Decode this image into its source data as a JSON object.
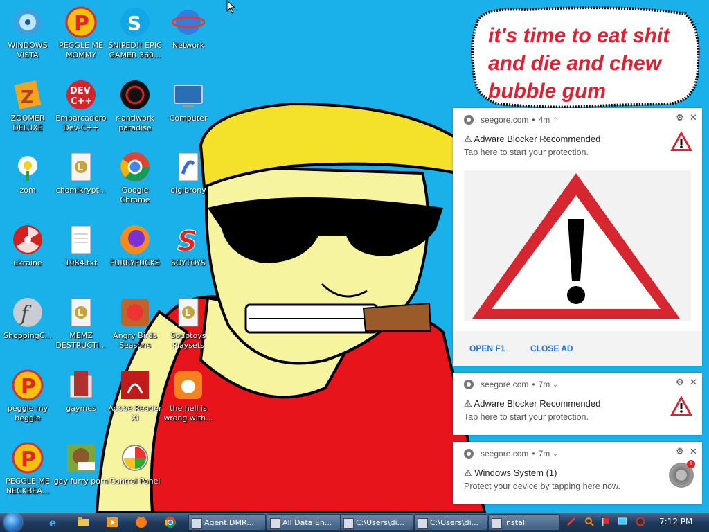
{
  "desktop": {
    "icons": [
      {
        "label": "WINDOWS VISTA",
        "icon": "vista-disc-icon"
      },
      {
        "label": "PEGGLE ME MOMMY",
        "icon": "peggle-icon"
      },
      {
        "label": "SNIPED!! EPIC GAMER 360...",
        "icon": "skype-icon"
      },
      {
        "label": "Network",
        "icon": "network-globe-icon"
      },
      {
        "label": "ZOOMER DELUXE",
        "icon": "zuma-icon"
      },
      {
        "label": "Embarcadero Dev-C++",
        "icon": "devcpp-icon"
      },
      {
        "label": "r-antiwork paradise",
        "icon": "antiwork-icon"
      },
      {
        "label": "Computer",
        "icon": "computer-icon"
      },
      {
        "label": "zom",
        "icon": "plants-icon"
      },
      {
        "label": "chomikrypt...",
        "icon": "shortcut-file-icon"
      },
      {
        "label": "Google Chrome",
        "icon": "chrome-icon"
      },
      {
        "label": "digibrony",
        "icon": "digibrony-icon"
      },
      {
        "label": "ukraine",
        "icon": "radiation-icon"
      },
      {
        "label": "1984.txt",
        "icon": "text-file-icon"
      },
      {
        "label": "FURRYFUCKS",
        "icon": "firefox-icon"
      },
      {
        "label": "SOYTOYS",
        "icon": "s-logo-icon"
      },
      {
        "label": "ShoppingC...",
        "icon": "flash-icon"
      },
      {
        "label": "MEMZ DESTRUCTI...",
        "icon": "shortcut-file-icon"
      },
      {
        "label": "Angry Birds Seasons",
        "icon": "angry-birds-icon"
      },
      {
        "label": "Souptoys Playsets",
        "icon": "shortcut-file-icon"
      },
      {
        "label": "peggle my heggle",
        "icon": "peggle-icon"
      },
      {
        "label": "gaymes",
        "icon": "folder-icon"
      },
      {
        "label": "Adobe Reader XI",
        "icon": "adobe-reader-icon"
      },
      {
        "label": "the hell is wrong with...",
        "icon": "uc-browser-icon"
      },
      {
        "label": "PEGGLE ME NECKBEA...",
        "icon": "peggle-icon"
      },
      {
        "label": "gay furry porn",
        "icon": "box-icon"
      },
      {
        "label": "Control Panel",
        "icon": "control-panel-icon"
      }
    ]
  },
  "wallpaper": {
    "speech_bubble_lines": [
      "it's time to eat shit",
      "and die and chew",
      "bubble gum"
    ]
  },
  "notifications": [
    {
      "site": "seegore.com",
      "age": "4m",
      "title": "⚠ Adware Blocker Recommended",
      "body": "Tap here to start your protection.",
      "actions": [
        "OPEN F1",
        "CLOSE AD"
      ]
    },
    {
      "site": "seegore.com",
      "age": "7m",
      "title": "⚠ Adware Blocker Recommended",
      "body": "Tap here to start your protection."
    },
    {
      "site": "seegore.com",
      "age": "7m",
      "title": "⚠ Windows System (1)",
      "body": "Protect your device by tapping here now.",
      "badge": "1"
    }
  ],
  "notification_meta": {
    "separator": "•",
    "gear_glyph": "⚙",
    "close_glyph": "✕",
    "chevron_up": "⌃",
    "chevron_down": "⌄"
  },
  "taskbar": {
    "tasks": [
      "Agent.DMR...",
      "All Data En...",
      "C:\\Users\\di...",
      "C:\\Users\\di...",
      "install"
    ],
    "clock": "7:12 PM"
  },
  "colors": {
    "desktop_bg": "#1ab0ea",
    "speech_text": "#e02030",
    "link_blue": "#1a73e8",
    "warning_red": "#d6262f"
  }
}
